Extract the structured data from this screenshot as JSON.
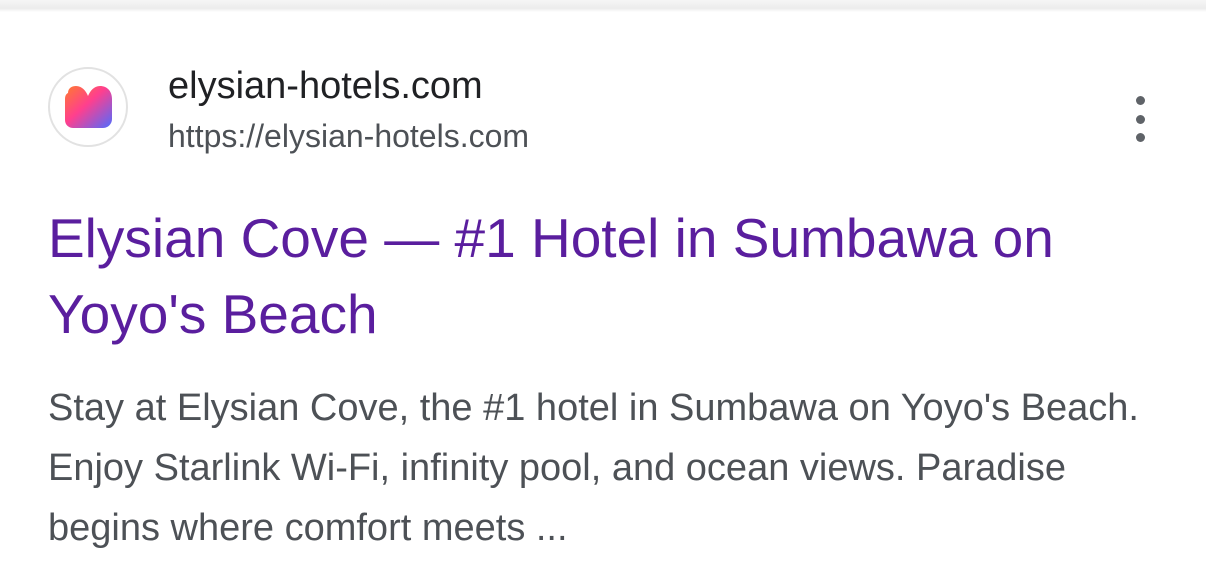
{
  "result": {
    "site_name": "elysian-hotels.com",
    "url": "https://elysian-hotels.com",
    "favicon_icon": "heart-logo-icon",
    "title": "Elysian Cove — #1 Hotel in Sumbawa on Yoyo's Beach",
    "snippet": "Stay at Elysian Cove, the #1 hotel in Sumbawa on Yoyo's Beach. Enjoy Starlink Wi-Fi, infinity pool, and ocean views. Paradise begins where comfort meets ...",
    "more_icon": "more-vert-icon"
  },
  "colors": {
    "title_visited": "#5a1e9e",
    "site_name": "#202124",
    "url": "#4d5156",
    "snippet": "#4d5156",
    "favicon_gradient_start": "#ff5e3a",
    "favicon_gradient_mid": "#ff3f8e",
    "favicon_gradient_end": "#4f6bff"
  }
}
